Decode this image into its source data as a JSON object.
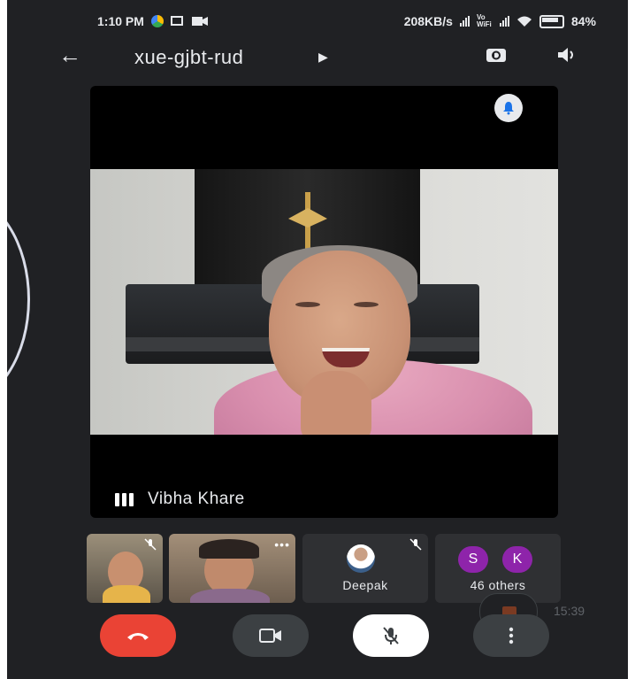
{
  "status_bar": {
    "time": "1:10 PM",
    "network_speed": "208KB/s",
    "vowifi": "Vo WiFi",
    "battery": "84%"
  },
  "header": {
    "meeting_code": "xue-gjbt-rud",
    "back_icon": "arrow-left-icon",
    "switch_camera_icon": "camera-switch-icon",
    "audio_icon": "speaker-icon"
  },
  "main_tile": {
    "speaker_name": "Vibha Khare",
    "pin_icon": "bell-icon"
  },
  "participants": [
    {
      "name": "",
      "muted": true
    },
    {
      "name": "",
      "muted": false
    },
    {
      "name": "Deepak",
      "muted": true
    },
    {
      "name": "46 others",
      "initials": [
        "S",
        "K"
      ]
    }
  ],
  "recording": {
    "elapsed": "15:39"
  },
  "controls": {
    "end_call": "end-call-icon",
    "camera": "video-camera-icon",
    "mic": "mic-off-icon",
    "more": "more-vertical-icon"
  },
  "colors": {
    "background": "#202124",
    "end_call": "#ea4335",
    "control": "#3c4043",
    "avatar": "#8e24aa"
  }
}
